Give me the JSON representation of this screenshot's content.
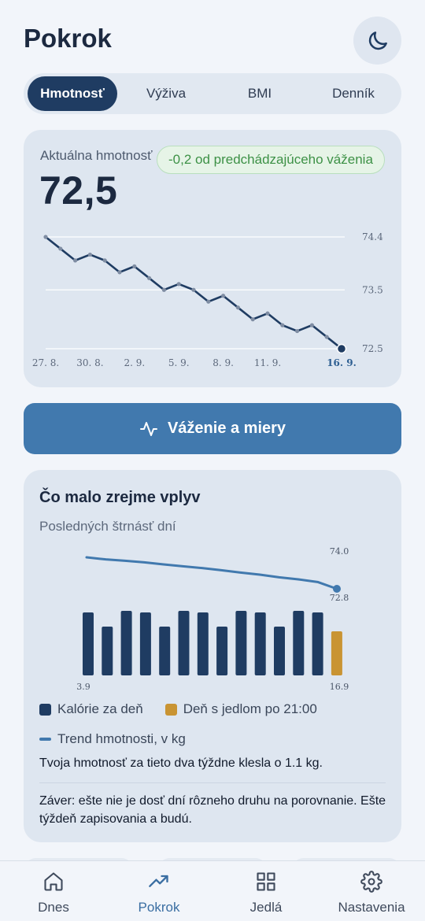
{
  "header": {
    "title": "Pokrok",
    "theme_icon": "moon-icon"
  },
  "tabs": [
    {
      "label": "Hmotnosť",
      "active": true
    },
    {
      "label": "Výživa",
      "active": false
    },
    {
      "label": "BMI",
      "active": false
    },
    {
      "label": "Denník",
      "active": false
    }
  ],
  "weight": {
    "label": "Aktuálna hmotnosť",
    "value": "72,5",
    "delta": "-0,2 od predchádzajúceho váženia"
  },
  "colors": {
    "navy": "#1f3c62",
    "accent": "#4179ae",
    "late_meal": "#c99433",
    "positive": "#3d9146"
  },
  "weigh_button": {
    "label": "Váženie a miery",
    "icon": "activity-icon"
  },
  "impact": {
    "title": "Čo malo zrejme vplyv",
    "subtitle": "Posledných štrnásť dní",
    "legend": {
      "calories": "Kalórie za deň",
      "late_meal": "Deň s jedlom po 21:00",
      "trend": "Trend hmotnosti, v kg"
    },
    "summary": "Tvoja hmotnosť za tieto dva týždne klesla o 1.1 kg.",
    "conclusion": "Záver: ešte nie je dosť dní rôzneho druhu na porovnanie. Ešte týždeň zapisovania a budú."
  },
  "nav": [
    {
      "label": "Dnes",
      "icon": "home-icon",
      "active": false
    },
    {
      "label": "Pokrok",
      "icon": "trending-up-icon",
      "active": true
    },
    {
      "label": "Jedlá",
      "icon": "grid-icon",
      "active": false
    },
    {
      "label": "Nastavenia",
      "icon": "gear-icon",
      "active": false
    }
  ],
  "chart_data": [
    {
      "type": "line",
      "x": [
        "27. 8.",
        "28. 8.",
        "29. 8.",
        "30. 8.",
        "31. 8.",
        "1. 9.",
        "2. 9.",
        "3. 9.",
        "4. 9.",
        "5. 9.",
        "6. 9.",
        "7. 9.",
        "8. 9.",
        "9. 9.",
        "10. 9.",
        "11. 9.",
        "12. 9.",
        "13. 9.",
        "14. 9.",
        "15. 9.",
        "16. 9."
      ],
      "x_tick_labels": [
        "27. 8.",
        "30. 8.",
        "2. 9.",
        "5. 9.",
        "8. 9.",
        "11. 9.",
        "16. 9."
      ],
      "highlighted_tick": "16. 9.",
      "series": [
        {
          "values": [
            74.4,
            74.2,
            74.0,
            74.1,
            74.0,
            73.8,
            73.9,
            73.7,
            73.5,
            73.6,
            73.5,
            73.3,
            73.4,
            73.2,
            73.0,
            73.1,
            72.9,
            72.8,
            72.9,
            72.7,
            72.5
          ]
        }
      ],
      "y_tick_labels": [
        "74.4",
        "73.5",
        "72.5"
      ],
      "ylim": [
        72.5,
        74.4
      ],
      "grid": true
    },
    {
      "type": "bar",
      "categories": [
        "3.9",
        "4.9",
        "5.9",
        "6.9",
        "7.9",
        "8.9",
        "9.9",
        "10.9",
        "11.9",
        "12.9",
        "13.9",
        "14.9",
        "15.9",
        "16.9"
      ],
      "x_tick_labels": [
        "3.9",
        "16.9"
      ],
      "bar_values": [
        0.8,
        0.62,
        0.82,
        0.8,
        0.62,
        0.82,
        0.8,
        0.62,
        0.82,
        0.8,
        0.62,
        0.82,
        0.8,
        0.56
      ],
      "bar_value_units": "relative to chart height (no calorie axis shown)",
      "late_meal_days": [
        "16.9"
      ],
      "trend_values": [
        74.0,
        73.92,
        73.87,
        73.81,
        73.73,
        73.66,
        73.59,
        73.51,
        73.42,
        73.34,
        73.24,
        73.16,
        73.06,
        72.8
      ],
      "trend_tick_labels": [
        "74.0",
        "72.8"
      ],
      "trend_ylim": [
        72.8,
        74.0
      ]
    }
  ]
}
